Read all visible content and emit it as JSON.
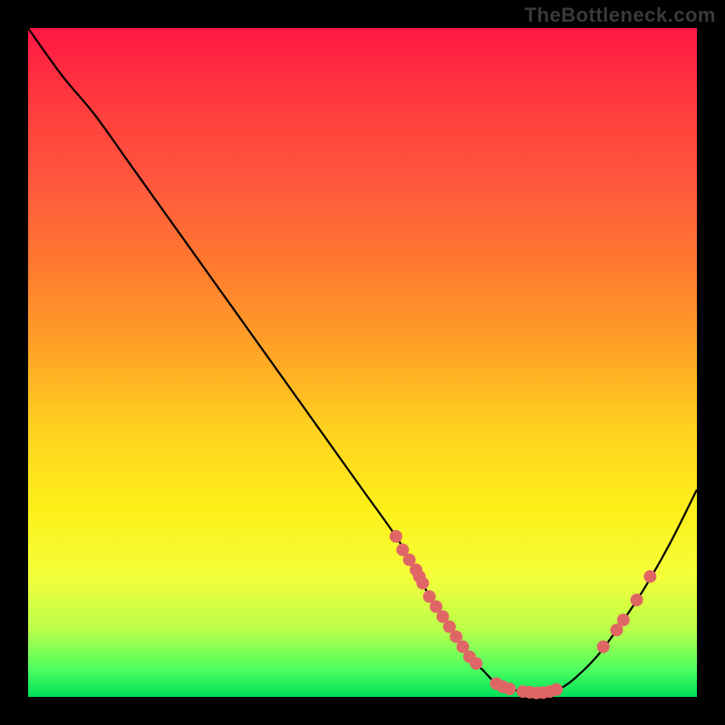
{
  "watermark": "TheBottleneck.com",
  "colors": {
    "page_bg": "#000000",
    "curve_stroke": "#000000",
    "dot_fill": "#e06666",
    "gradient_stops": [
      "#ff1744",
      "#ff3d3d",
      "#ff5a3d",
      "#ff7b2e",
      "#ffa326",
      "#ffd21f",
      "#fdf01a",
      "#f4ff3a",
      "#baff4a",
      "#4aff60",
      "#00e05a"
    ]
  },
  "chart_data": {
    "type": "line",
    "title": "",
    "xlabel": "",
    "ylabel": "",
    "xlim": [
      0,
      100
    ],
    "ylim": [
      0,
      100
    ],
    "x": [
      0,
      5,
      10,
      15,
      20,
      25,
      30,
      35,
      40,
      45,
      50,
      55,
      58,
      60,
      62,
      64,
      66,
      68,
      70,
      72,
      74,
      76,
      78,
      80,
      82,
      85,
      88,
      92,
      96,
      100
    ],
    "y": [
      100,
      93,
      87,
      80,
      73,
      66,
      59,
      52,
      45,
      38,
      31,
      24,
      19,
      15,
      12,
      9,
      6,
      4,
      2,
      1.2,
      0.8,
      0.6,
      0.8,
      1.5,
      3,
      6,
      10,
      16,
      23,
      31
    ],
    "dots": [
      {
        "x": 55,
        "y": 24
      },
      {
        "x": 56,
        "y": 22
      },
      {
        "x": 57,
        "y": 20.5
      },
      {
        "x": 58,
        "y": 19
      },
      {
        "x": 58.5,
        "y": 18
      },
      {
        "x": 59,
        "y": 17
      },
      {
        "x": 60,
        "y": 15
      },
      {
        "x": 61,
        "y": 13.5
      },
      {
        "x": 62,
        "y": 12
      },
      {
        "x": 63,
        "y": 10.5
      },
      {
        "x": 64,
        "y": 9
      },
      {
        "x": 65,
        "y": 7.5
      },
      {
        "x": 66,
        "y": 6
      },
      {
        "x": 67,
        "y": 5
      },
      {
        "x": 70,
        "y": 2
      },
      {
        "x": 71,
        "y": 1.5
      },
      {
        "x": 72,
        "y": 1.2
      },
      {
        "x": 74,
        "y": 0.8
      },
      {
        "x": 75,
        "y": 0.7
      },
      {
        "x": 76,
        "y": 0.6
      },
      {
        "x": 77,
        "y": 0.65
      },
      {
        "x": 78,
        "y": 0.8
      },
      {
        "x": 79,
        "y": 1.1
      },
      {
        "x": 86,
        "y": 7.5
      },
      {
        "x": 88,
        "y": 10
      },
      {
        "x": 89,
        "y": 11.5
      },
      {
        "x": 91,
        "y": 14.5
      },
      {
        "x": 93,
        "y": 18
      }
    ]
  }
}
